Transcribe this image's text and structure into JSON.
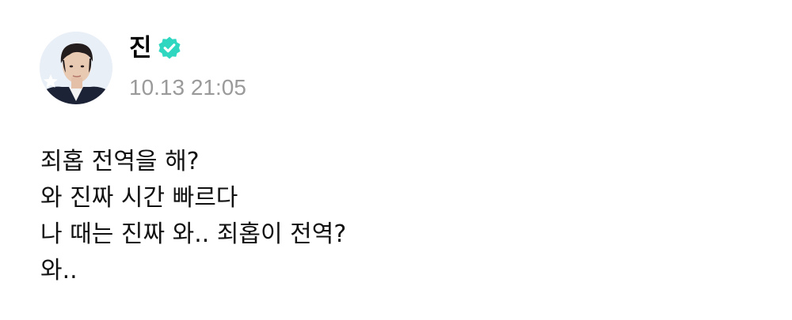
{
  "post": {
    "author": {
      "name": "진",
      "verified": true,
      "avatar_icon": "profile-photo",
      "verified_icon": "verified-badge-icon",
      "verified_color": "#2fd7c1"
    },
    "timestamp": "10.13 21:05",
    "lines": [
      "죄홉 전역을 해?",
      "와 진짜 시간 빠르다",
      "나 때는 진짜 와.. 죄홉이 전역?",
      "와.."
    ]
  }
}
